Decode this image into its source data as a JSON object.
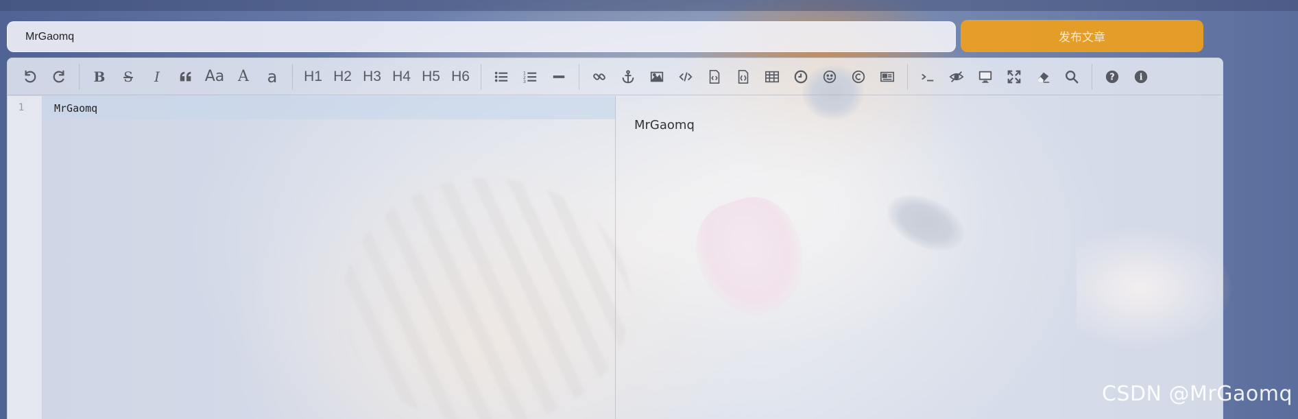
{
  "title_input": {
    "value": "MrGaomq"
  },
  "publish_button": {
    "label": "发布文章"
  },
  "toolbar": {
    "items": [
      {
        "name": "undo-icon",
        "glyph": "↶"
      },
      {
        "name": "redo-icon",
        "glyph": "↷"
      },
      {
        "name": "bold-icon",
        "glyph": "B"
      },
      {
        "name": "strikethrough-icon",
        "glyph": "S"
      },
      {
        "name": "italic-icon",
        "glyph": "I"
      },
      {
        "name": "quote-icon",
        "glyph": "❝"
      },
      {
        "name": "uppercase-icon",
        "glyph": "Aa"
      },
      {
        "name": "ucwords-icon",
        "glyph": "A"
      },
      {
        "name": "lowercase-icon",
        "glyph": "a"
      },
      {
        "name": "h1-button",
        "glyph": "H1"
      },
      {
        "name": "h2-button",
        "glyph": "H2"
      },
      {
        "name": "h3-button",
        "glyph": "H3"
      },
      {
        "name": "h4-button",
        "glyph": "H4"
      },
      {
        "name": "h5-button",
        "glyph": "H5"
      },
      {
        "name": "h6-button",
        "glyph": "H6"
      }
    ]
  },
  "editor": {
    "line_number": "1",
    "code_line": "MrGaomq"
  },
  "preview": {
    "text": "MrGaomq"
  },
  "watermark": {
    "text": "CSDN @MrGaomq"
  },
  "colors": {
    "accent": "#f0a01e",
    "toolbar_icon": "#555a63"
  }
}
